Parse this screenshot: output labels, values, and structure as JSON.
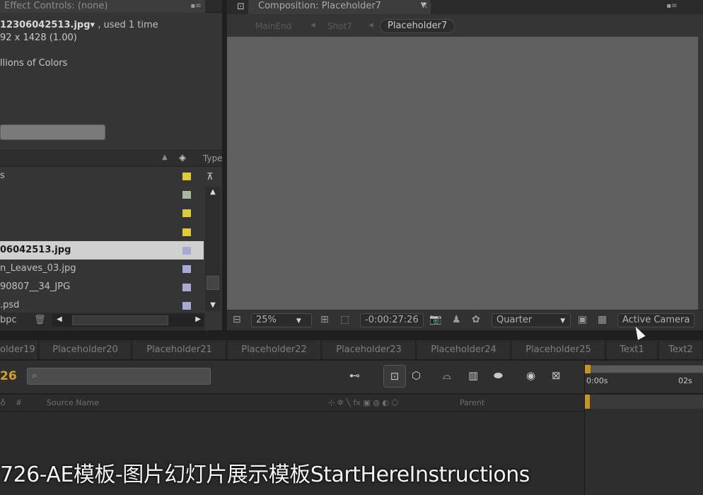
{
  "effect_controls": {
    "tab_label": "Effect Controls: (none)",
    "file_name": "12306042513.jpg",
    "file_name_caret": "▾",
    "used": ", used 1 time",
    "dimensions": "92 x 1428 (1.00)",
    "colors": "llions of Colors"
  },
  "project": {
    "type_header": "Type",
    "rows": [
      {
        "name": "s",
        "color": "#e0c93a",
        "selected": false
      },
      {
        "name": "",
        "color": "#a9b8a0",
        "selected": false
      },
      {
        "name": "",
        "color": "#e0c93a",
        "selected": false
      },
      {
        "name": "",
        "color": "#e0c93a",
        "selected": false
      },
      {
        "name": "06042513.jpg",
        "color": "#a9a9d6",
        "selected": true
      },
      {
        "name": "n_Leaves_03.jpg",
        "color": "#a9a9d6",
        "selected": false
      },
      {
        "name": "90807__34_JPG",
        "color": "#a9a9d6",
        "selected": false
      },
      {
        "name": ".psd",
        "color": "#a9a9d6",
        "selected": false
      }
    ],
    "bpc": "bpc"
  },
  "composition": {
    "tab_label": "Composition: Placeholder7",
    "breadcrumbs": [
      "MainEnd",
      "Shot7"
    ],
    "current": "Placeholder7",
    "toolbar": {
      "zoom": "25%",
      "timecode": "-0:00:27:26",
      "resolution": "Quarter",
      "camera": "Active Camera"
    }
  },
  "timeline_tabs": [
    "older19",
    "Placeholder20",
    "Placeholder21",
    "Placeholder22",
    "Placeholder23",
    "Placeholder24",
    "Placeholder25",
    "Text1",
    "Text2"
  ],
  "timeline": {
    "timecode": "26",
    "columns": {
      "number": "#",
      "source_name": "Source Name",
      "switches": "⊹ ✲ ╲ fx ▣ ◍ ◐ ⬡",
      "parent": "Parent"
    },
    "ruler": {
      "start": "0:00s",
      "mark": "02s"
    }
  },
  "caption": "726-AE模板-图片幻灯片展示模板StartHereInstructions"
}
